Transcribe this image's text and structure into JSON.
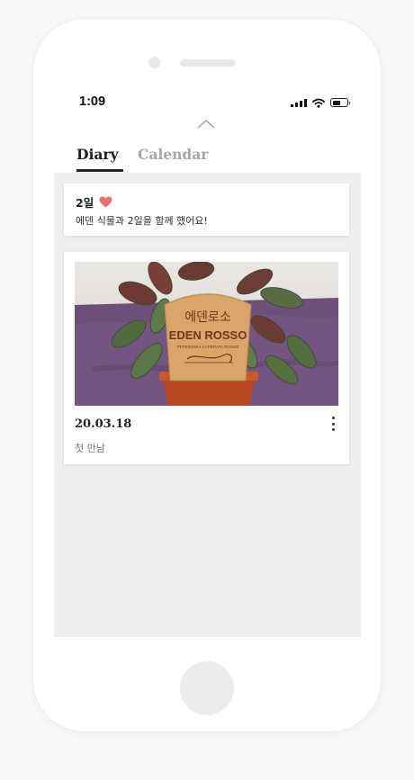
{
  "status_bar": {
    "time": "1:09",
    "icons": [
      "signal-icon",
      "wifi-icon",
      "battery-icon"
    ],
    "battery_level": 0.55
  },
  "tabs": [
    {
      "label": "Diary",
      "active": true
    },
    {
      "label": "Calendar",
      "active": false
    }
  ],
  "memo": {
    "days": "2일",
    "text": "에덴 식물과 2일을 함께 했어요!",
    "heart_color": "#ec6d6d"
  },
  "entries": [
    {
      "date": "20.03.18",
      "caption": "첫 만남",
      "photo_sign": {
        "line1": "에덴로소",
        "line2": "EDEN ROSSO",
        "line3": "PEPEROMIA CAPERATA ROSSO"
      }
    }
  ],
  "fab": {
    "icon": "pencil-icon",
    "color": "#5b8f62"
  },
  "colors": {
    "background": "#f7f7f7",
    "content_bg": "#efefef",
    "active_tab": "#1e1e1e",
    "inactive_tab": "#a6a6a6"
  }
}
